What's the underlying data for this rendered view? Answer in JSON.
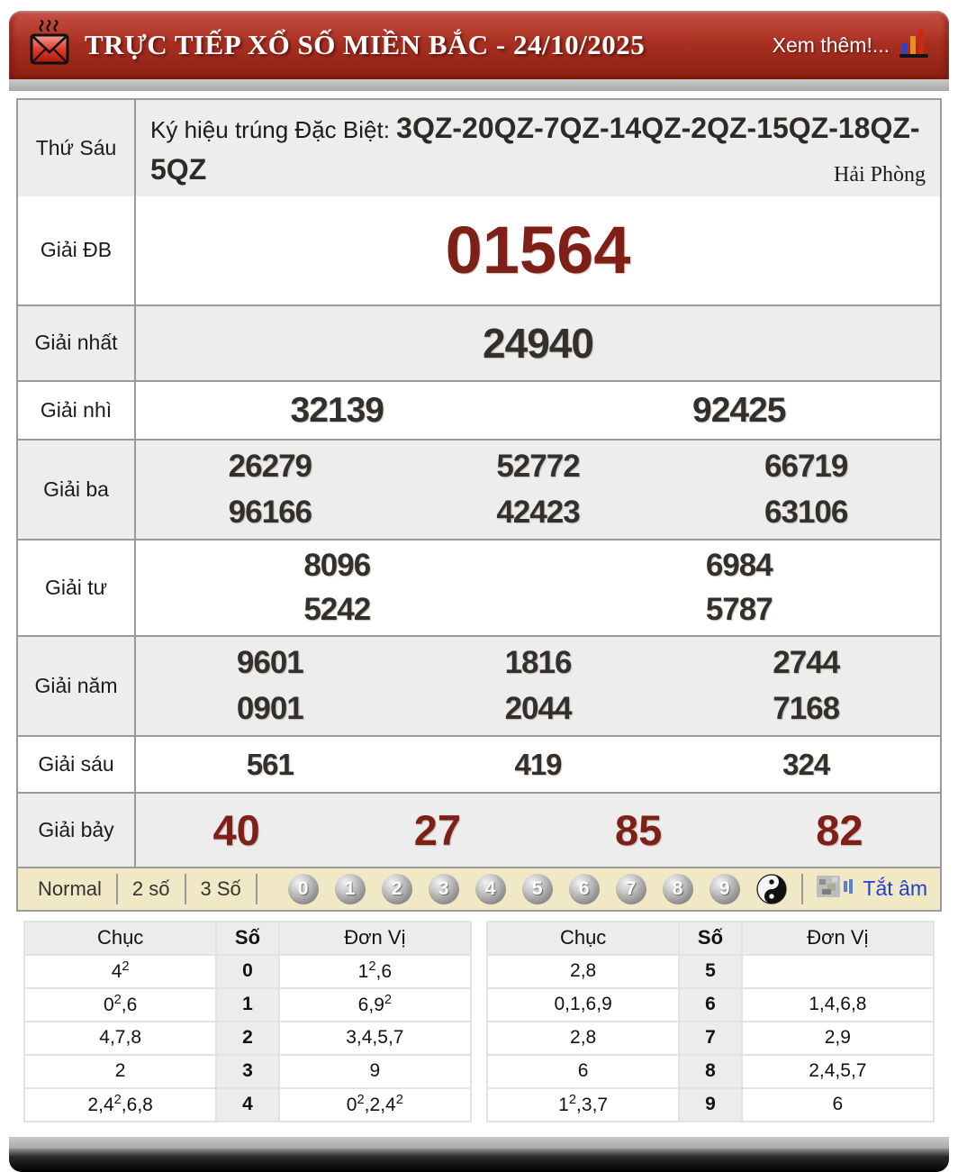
{
  "header": {
    "title": "TRỰC TIẾP XỔ SỐ MIỀN BẮC - 24/10/2025",
    "more_label": "Xem thêm!...",
    "mail_icon": "hot-mail-icon",
    "chart_icon": "bar-chart-icon"
  },
  "info": {
    "day": "Thứ Sáu",
    "sign_label": "Ký hiệu trúng Đặc Biệt: ",
    "sign_codes": "3QZ-20QZ-7QZ-14QZ-2QZ-15QZ-18QZ-5QZ",
    "province": "Hải Phòng"
  },
  "prizes": [
    {
      "label": "Giải ĐB",
      "style": "db",
      "lines": [
        [
          "01564"
        ]
      ]
    },
    {
      "label": "Giải nhất",
      "style": "nhat",
      "lines": [
        [
          "24940"
        ]
      ]
    },
    {
      "label": "Giải nhì",
      "style": "nhi",
      "lines": [
        [
          "32139",
          "92425"
        ]
      ]
    },
    {
      "label": "Giải ba",
      "style": "ba",
      "lines": [
        [
          "26279",
          "52772",
          "66719"
        ],
        [
          "96166",
          "42423",
          "63106"
        ]
      ]
    },
    {
      "label": "Giải tư",
      "style": "tu",
      "lines": [
        [
          "8096",
          "6984"
        ],
        [
          "5242",
          "5787"
        ]
      ]
    },
    {
      "label": "Giải năm",
      "style": "nam",
      "lines": [
        [
          "9601",
          "1816",
          "2744"
        ],
        [
          "0901",
          "2044",
          "7168"
        ]
      ]
    },
    {
      "label": "Giải sáu",
      "style": "sau",
      "lines": [
        [
          "561",
          "419",
          "324"
        ]
      ]
    },
    {
      "label": "Giải bảy",
      "style": "bay",
      "lines": [
        [
          "40",
          "27",
          "85",
          "82"
        ]
      ]
    }
  ],
  "controls": {
    "modes": [
      "Normal",
      "2 số",
      "3 Số"
    ],
    "balls": [
      "0",
      "1",
      "2",
      "3",
      "4",
      "5",
      "6",
      "7",
      "8",
      "9"
    ],
    "yin_yang_icon": "yin-yang-icon",
    "speaker_icon": "speaker-icon",
    "mute_label": "Tắt âm"
  },
  "digit_summary": {
    "col_headers": [
      "Chục",
      "Số",
      "Đơn Vị"
    ],
    "left_rows": [
      {
        "chuc": "4²",
        "so": "0",
        "donvi": "1²,6"
      },
      {
        "chuc": "0²,6",
        "so": "1",
        "donvi": "6,9²"
      },
      {
        "chuc": "4,7,8",
        "so": "2",
        "donvi": "3,4,5,7"
      },
      {
        "chuc": "2",
        "so": "3",
        "donvi": "9"
      },
      {
        "chuc": "2,4²,6,8",
        "so": "4",
        "donvi": "0²,2,4²"
      }
    ],
    "right_rows": [
      {
        "chuc": "2,8",
        "so": "5",
        "donvi": ""
      },
      {
        "chuc": "0,1,6,9",
        "so": "6",
        "donvi": "1,4,6,8"
      },
      {
        "chuc": "2,8",
        "so": "7",
        "donvi": "2,9"
      },
      {
        "chuc": "6",
        "so": "8",
        "donvi": "2,4,5,7"
      },
      {
        "chuc": "1²,3,7",
        "so": "9",
        "donvi": "6"
      }
    ]
  },
  "colors": {
    "accent_red": "#7e1f18",
    "header_red_top": "#c24a3c",
    "header_red_bottom": "#8c2013",
    "control_bg": "#f1e8c6",
    "link_blue": "#1f3fd0",
    "border_gray": "#9a9a9a",
    "number_dark": "#33302b"
  }
}
